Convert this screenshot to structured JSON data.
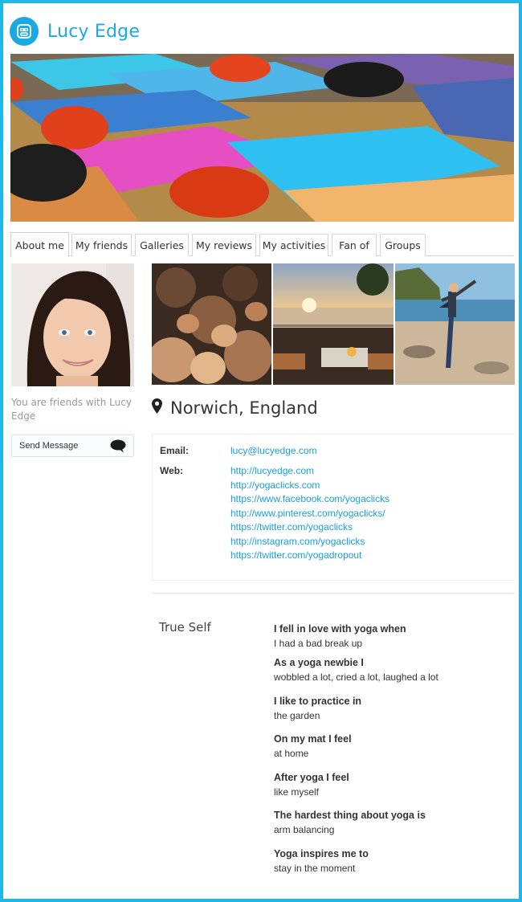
{
  "site": {
    "title": "Lucy Edge",
    "logo_icon": "yoga-face-icon",
    "accent": "#1aa9e0"
  },
  "tabs": [
    {
      "label": "About me",
      "active": true
    },
    {
      "label": "My friends"
    },
    {
      "label": "Galleries"
    },
    {
      "label": "My reviews"
    },
    {
      "label": "My activities"
    },
    {
      "label": "Fan of"
    },
    {
      "label": "Groups"
    }
  ],
  "profile": {
    "friend_status": "You are friends with Lucy Edge",
    "send_message_label": "Send Message",
    "location": "Norwich, England",
    "email_label": "Email:",
    "email": "lucy@lucyedge.com",
    "web_label": "Web:",
    "web_links": [
      "http://lucyedge.com",
      "http://yogaclicks.com",
      "https://www.facebook.com/yogaclicks",
      "http://www.pinterest.com/yogaclicks/",
      "https://twitter.com/yogaclicks",
      "http://instagram.com/yogaclicks",
      "https://twitter.com/yogadropout"
    ]
  },
  "true_self": {
    "title": "True Self",
    "items": [
      {
        "q": "I fell in love with yoga when",
        "a": "I had a bad break up"
      },
      {
        "q": "As a yoga newbie I",
        "a": "wobbled a lot, cried a lot, laughed a lot"
      },
      {
        "q": "I like to practice in",
        "a": "the garden"
      },
      {
        "q": "On my mat I feel",
        "a": "at home"
      },
      {
        "q": "After yoga I feel",
        "a": "like myself"
      },
      {
        "q": "The hardest thing about yoga is",
        "a": "arm balancing"
      },
      {
        "q": "Yoga inspires me to",
        "a": "stay in the moment"
      }
    ]
  }
}
